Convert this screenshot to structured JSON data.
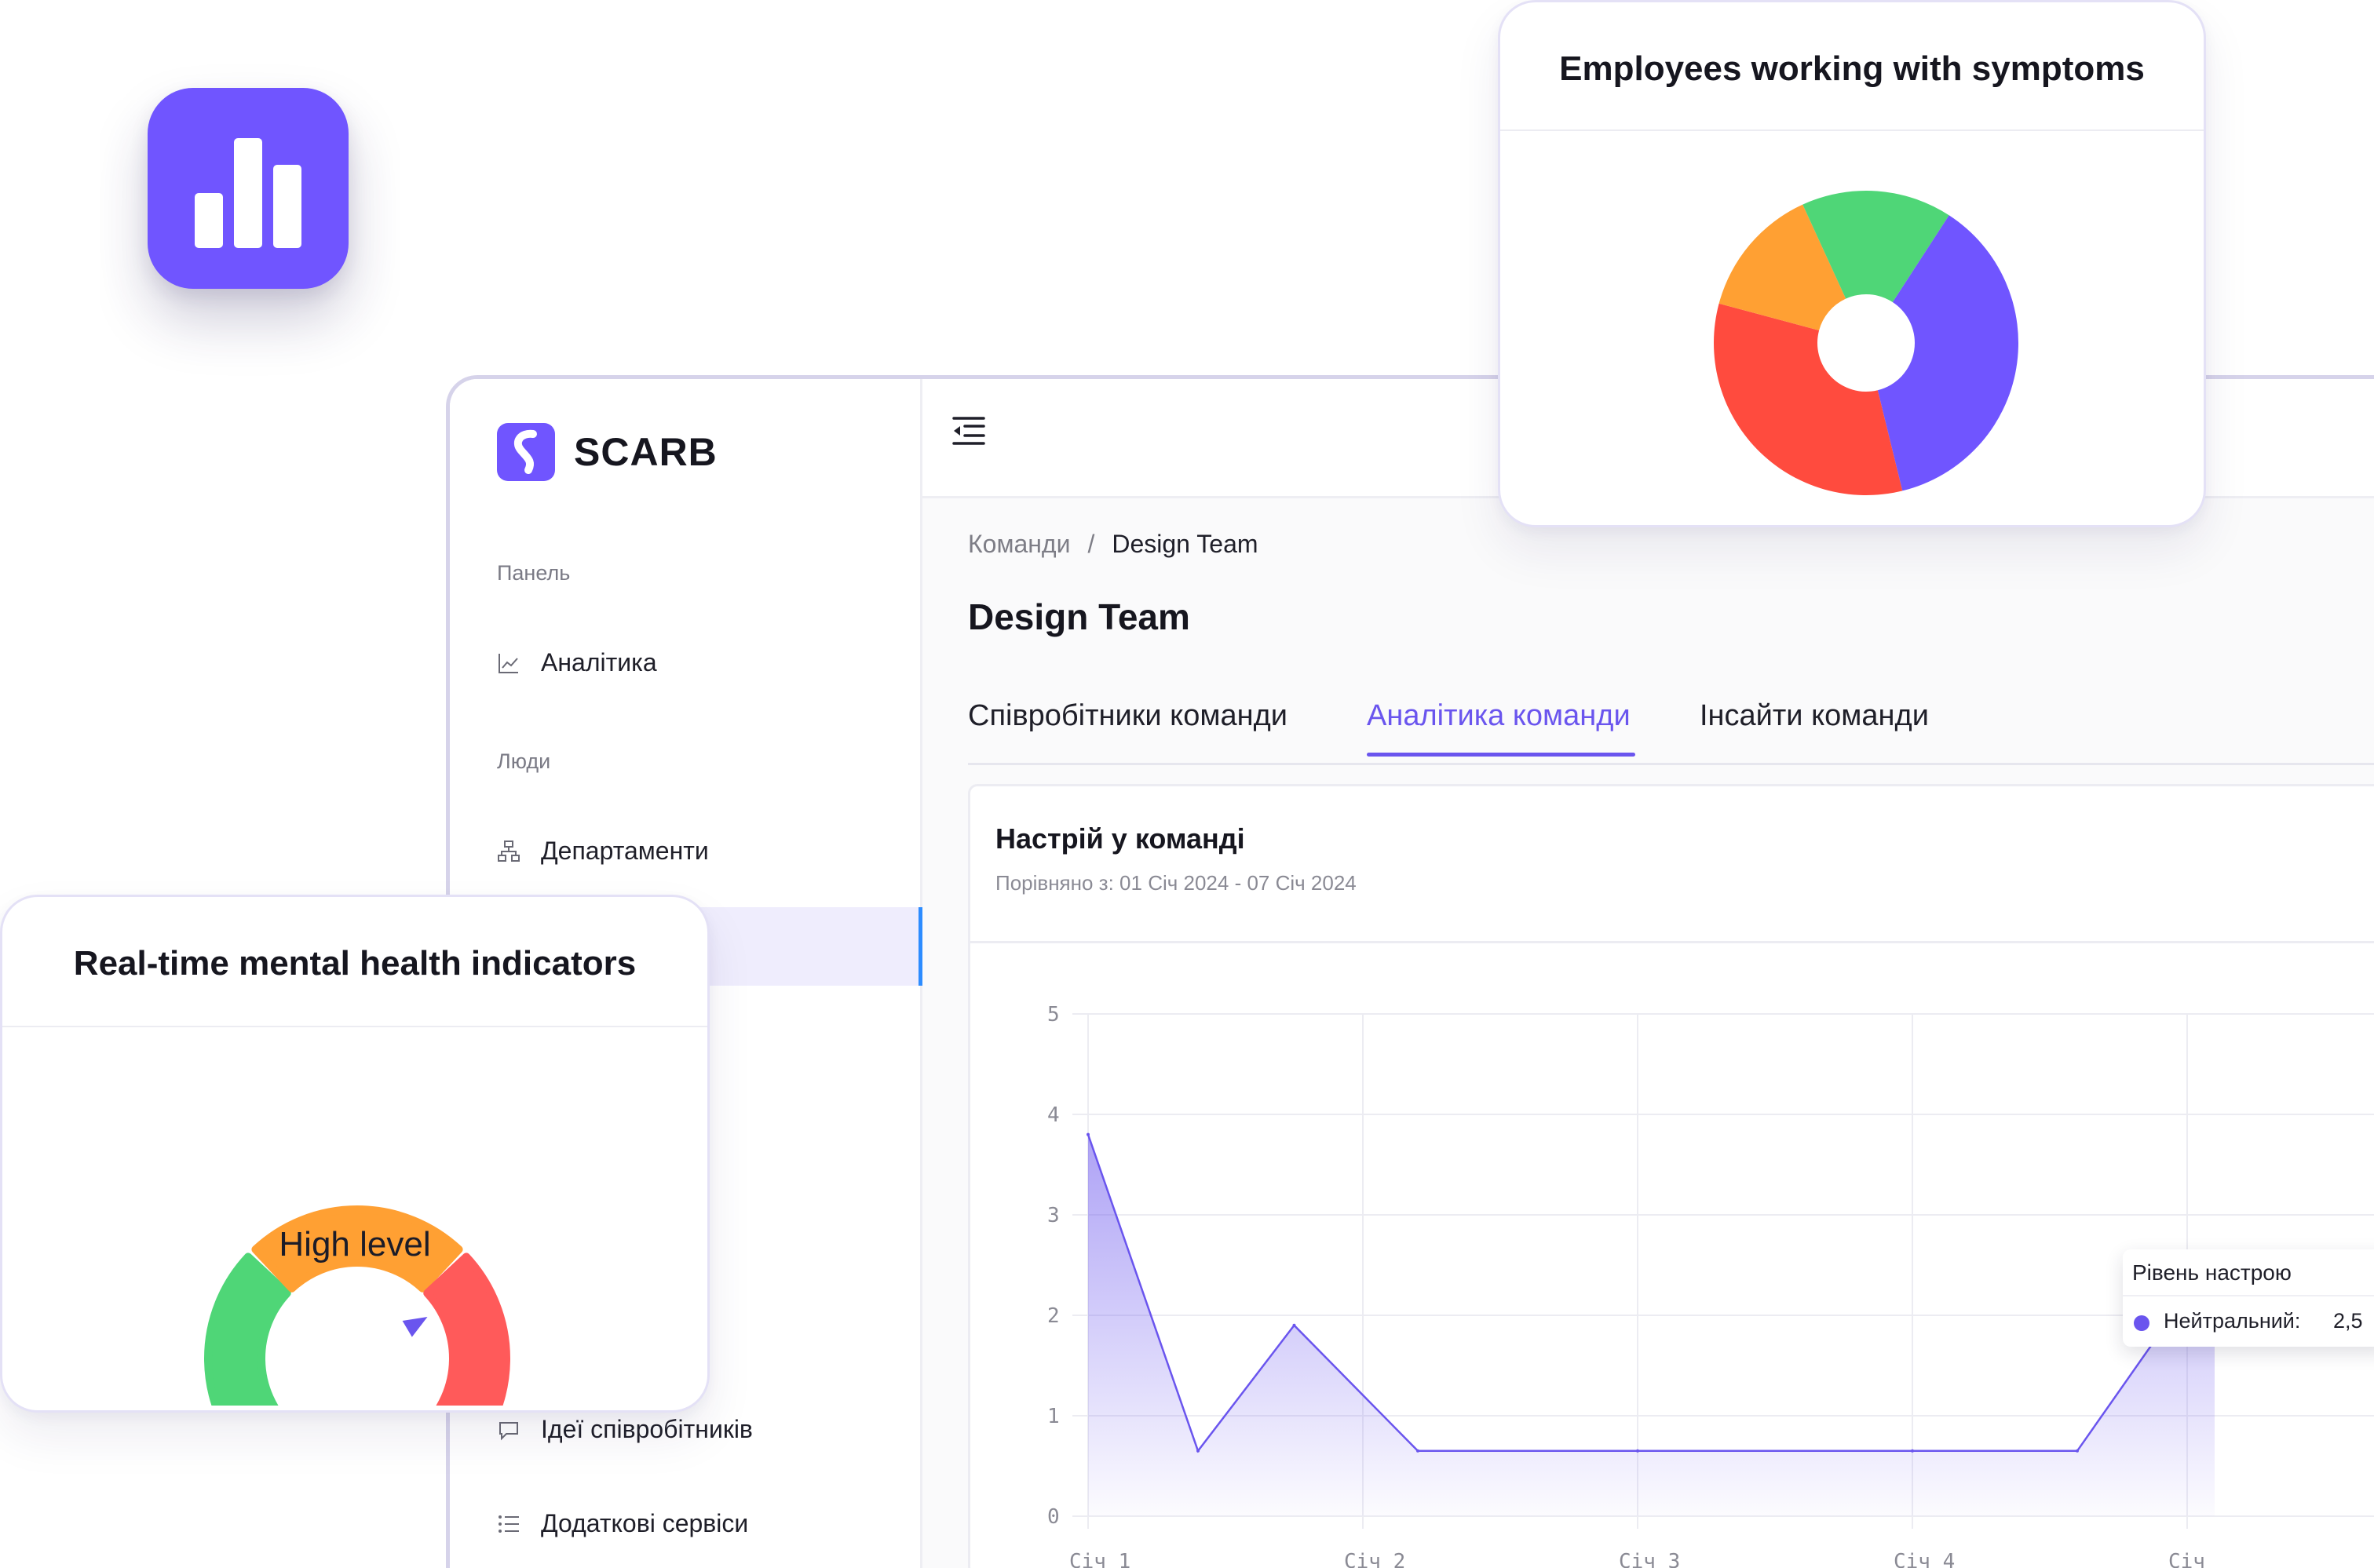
{
  "brand": {
    "name": "SCARB"
  },
  "sidebar": {
    "groups": [
      {
        "label": "Панель"
      },
      {
        "label": "Люди"
      }
    ],
    "items": [
      {
        "label": "Аналітика",
        "icon": "line-chart-icon"
      },
      {
        "label": "Департаменти",
        "icon": "org-chart-icon"
      },
      {
        "label": "Ідеї співробітників",
        "icon": "lightbulb-icon"
      },
      {
        "label": "Додаткові сервіси",
        "icon": "list-icon"
      }
    ]
  },
  "breadcrumb": {
    "parent": "Команди",
    "separator": "/",
    "current": "Design Team"
  },
  "page": {
    "title": "Design Team"
  },
  "tabs": [
    {
      "label": "Співробітники команди",
      "active": false
    },
    {
      "label": "Аналітика команди",
      "active": true
    },
    {
      "label": "Інсайти команди",
      "active": false
    }
  ],
  "mood_card": {
    "title": "Настрій у команді",
    "subtitle": "Порівняно з: 01 Січ 2024 - 07 Січ 2024"
  },
  "chart_data": [
    {
      "type": "area",
      "ylim": [
        0,
        5
      ],
      "y_ticks": [
        "0",
        "1",
        "2",
        "3",
        "4",
        "5"
      ],
      "x_ticks": [
        "Січ 1",
        "Січ 2",
        "Січ 3",
        "Січ 4",
        "Січ"
      ],
      "series": [
        {
          "x": [
            0,
            0.4,
            0.75,
            1.2,
            2,
            3,
            3.6,
            4.1
          ],
          "values": [
            3.8,
            0.65,
            1.9,
            0.65,
            0.65,
            0.65,
            0.65,
            2.6
          ],
          "color": "#6a55ee"
        }
      ],
      "tooltip": {
        "title": "Рівень настрою",
        "label": "Нейтральний:",
        "value": "2,5"
      }
    },
    {
      "type": "pie",
      "title": "Employees working with symptoms",
      "slices": [
        {
          "value": 37,
          "color": "#7055ff"
        },
        {
          "value": 33,
          "color": "#ff4b3e"
        },
        {
          "value": 14,
          "color": "#ffa033"
        },
        {
          "value": 16,
          "color": "#4fd677"
        }
      ]
    },
    {
      "type": "gauge",
      "title": "Real-time mental health indicators",
      "label": "High level",
      "segments": [
        {
          "name": "low",
          "color": "#4fd677"
        },
        {
          "name": "medium",
          "color": "#ffa033"
        },
        {
          "name": "high",
          "color": "#ff5a5a"
        }
      ],
      "pointer_level": 0.72
    }
  ],
  "colors": {
    "accent": "#7055ff",
    "tab_active": "#6a55ee",
    "active_nav_bg": "#efedfd",
    "active_nav_marker": "#2d8cff"
  }
}
